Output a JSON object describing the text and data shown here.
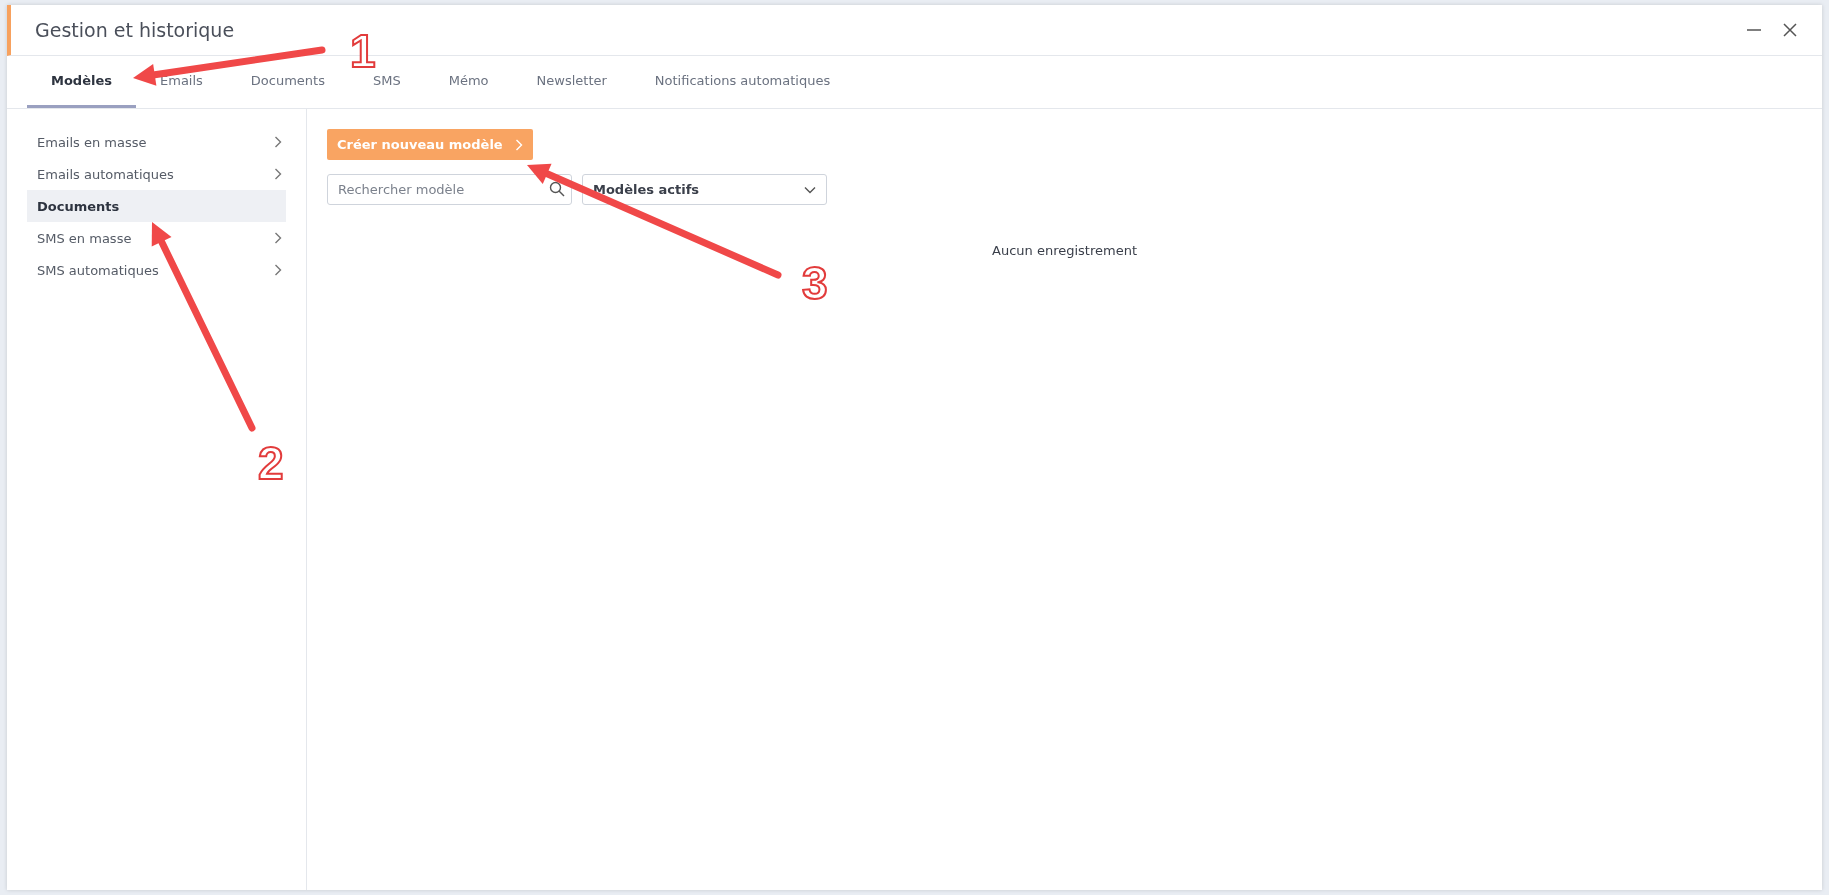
{
  "window": {
    "title": "Gestion et historique"
  },
  "tabs": [
    {
      "label": "Modèles",
      "selected": true
    },
    {
      "label": "Emails",
      "selected": false
    },
    {
      "label": "Documents",
      "selected": false
    },
    {
      "label": "SMS",
      "selected": false
    },
    {
      "label": "Mémo",
      "selected": false
    },
    {
      "label": "Newsletter",
      "selected": false
    },
    {
      "label": "Notifications automatiques",
      "selected": false
    }
  ],
  "sidebar": {
    "items": [
      {
        "label": "Emails en masse",
        "selected": false,
        "expandable": true
      },
      {
        "label": "Emails automatiques",
        "selected": false,
        "expandable": true
      },
      {
        "label": "Documents",
        "selected": true,
        "expandable": false
      },
      {
        "label": "SMS en masse",
        "selected": false,
        "expandable": true
      },
      {
        "label": "SMS automatiques",
        "selected": false,
        "expandable": true
      }
    ]
  },
  "main": {
    "create_button": "Créer nouveau modèle",
    "search": {
      "placeholder": "Rechercher modèle"
    },
    "filter": {
      "value": "Modèles actifs"
    },
    "empty_message": "Aucun enregistrement"
  },
  "annotations": [
    {
      "label": "1"
    },
    {
      "label": "2"
    },
    {
      "label": "3"
    }
  ]
}
